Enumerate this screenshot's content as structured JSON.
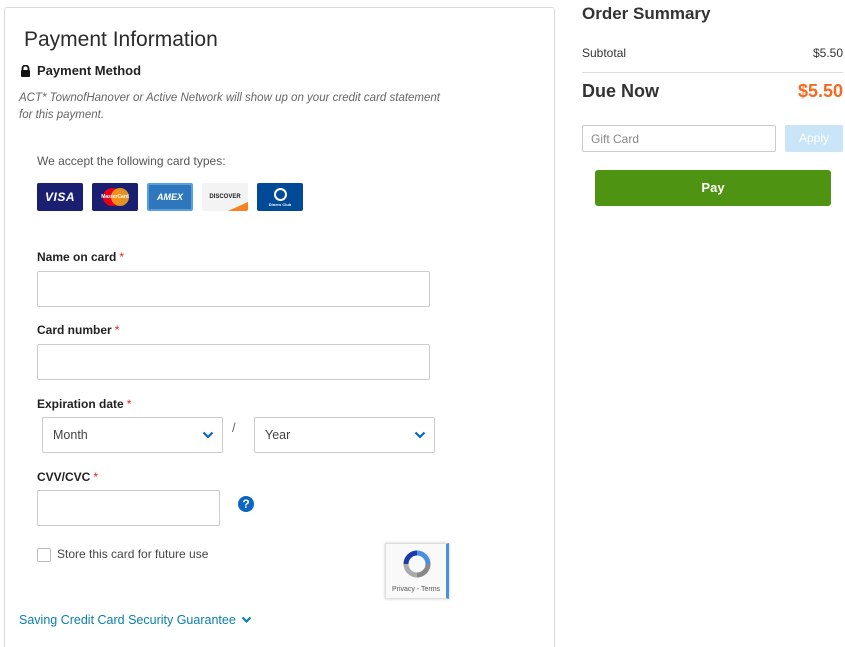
{
  "payment": {
    "title": "Payment Information",
    "method_label": "Payment Method",
    "statement": "ACT* TownofHanover or Active Network will show up on your credit card statement for this payment.",
    "accept_text": "We accept the following card types:",
    "cards": [
      {
        "name": "visa-card-icon",
        "label": "VISA"
      },
      {
        "name": "mastercard-card-icon",
        "label": "MasterCard"
      },
      {
        "name": "amex-card-icon",
        "label": "AMEX"
      },
      {
        "name": "discover-card-icon",
        "label": "DISCOVER"
      },
      {
        "name": "diners-card-icon",
        "label": "Diners Club"
      }
    ],
    "name_label": "Name on card",
    "card_number_label": "Card number",
    "expiration_label": "Expiration date",
    "month_value": "Month",
    "slash": "/",
    "year_value": "Year",
    "cvv_label": "CVV/CVC",
    "required_mark": "*",
    "help_icon": "?",
    "store_label": "Store this card for future use",
    "recaptcha_text": "Privacy - Terms",
    "saving_link": "Saving Credit Card Security Guarantee"
  },
  "summary": {
    "title": "Order Summary",
    "subtotal_label": "Subtotal",
    "subtotal_value": "$5.50",
    "due_label": "Due Now",
    "due_value": "$5.50",
    "gift_placeholder": "Gift Card",
    "apply_label": "Apply",
    "pay_label": "Pay"
  },
  "colors": {
    "accent_orange": "#f26b21",
    "pay_green": "#4e9311",
    "link_blue": "#0b7fab",
    "required_red": "#e2231a"
  }
}
